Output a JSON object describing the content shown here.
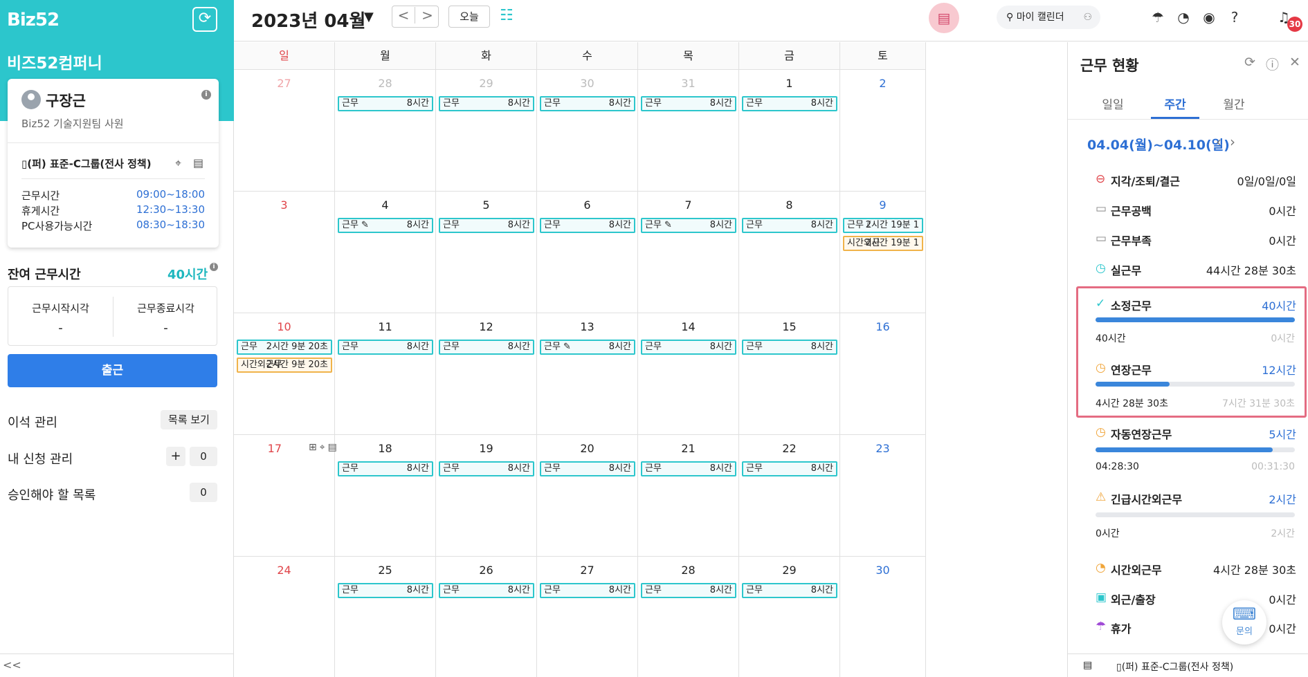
{
  "app": {
    "logo": "Biz52",
    "company": "비즈52컴퍼니"
  },
  "user": {
    "name": "구장근",
    "dept": "Biz52 기술지원팀 사원",
    "policy": "(퍼) 표준-C그룹(전사 정책)",
    "times": [
      {
        "label": "근무시간",
        "value": "09:00~18:00"
      },
      {
        "label": "휴게시간",
        "value": "12:30~13:30"
      },
      {
        "label": "PC사용가능시간",
        "value": "08:30~18:30"
      }
    ]
  },
  "remaining": {
    "label": "잔여 근무시간",
    "value": "40시간"
  },
  "clock": {
    "start_label": "근무시작시각",
    "start_value": "-",
    "end_label": "근무종료시각",
    "end_value": "-"
  },
  "checkin_label": "출근",
  "side": {
    "away": "이석 관리",
    "list_view": "목록 보기",
    "my_requests": "내 신청 관리",
    "my_requests_plus": "+",
    "my_requests_count": "0",
    "approve": "승인해야 할 목록",
    "approve_count": "0",
    "collapse": "<<"
  },
  "header": {
    "month": "2023년 04월",
    "caret": "▼",
    "prev": "<",
    "next": ">",
    "today": "오늘",
    "my_calendar": "마이 캘린더",
    "notif_count": "30"
  },
  "weekdays": [
    "일",
    "월",
    "화",
    "수",
    "목",
    "금",
    "토"
  ],
  "calendar": {
    "weeks": [
      {
        "days": [
          "27",
          "28",
          "29",
          "30",
          "31",
          "1",
          "2"
        ],
        "other": [
          true,
          true,
          true,
          true,
          true,
          false,
          false
        ]
      },
      {
        "days": [
          "3",
          "4",
          "5",
          "6",
          "7",
          "8",
          "9"
        ],
        "other": [
          false,
          false,
          false,
          false,
          false,
          false,
          false
        ]
      },
      {
        "days": [
          "10",
          "11",
          "12",
          "13",
          "14",
          "15",
          "16"
        ],
        "other": [
          false,
          false,
          false,
          false,
          false,
          false,
          false
        ]
      },
      {
        "days": [
          "17",
          "18",
          "19",
          "20",
          "21",
          "22",
          "23"
        ],
        "other": [
          false,
          false,
          false,
          false,
          false,
          false,
          false
        ]
      },
      {
        "days": [
          "24",
          "25",
          "26",
          "27",
          "28",
          "29",
          "30"
        ],
        "other": [
          false,
          false,
          false,
          false,
          false,
          false,
          false
        ]
      }
    ],
    "work_label": "근무",
    "hours_label": "8시간",
    "sat9_work": "2시간 19분 1",
    "sat9_ot_label": "시간외근",
    "sat9_ot": "2시간 19분 1",
    "sun10_work": "2시간 9분 20초",
    "sun10_ot_label": "시간외근무",
    "sun10_ot": "2시간 9분 20초"
  },
  "panel": {
    "title": "근무 현황",
    "tabs": [
      "일일",
      "주간",
      "월간"
    ],
    "active_tab": 1,
    "range": "04.04(월)~04.10(일)",
    "stats": [
      {
        "label": "지각/조퇴/결근",
        "value": "0일/0일/0일",
        "icon": "minus-circle-icon"
      },
      {
        "label": "근무공백",
        "value": "0시간",
        "icon": "monitor-icon"
      },
      {
        "label": "근무부족",
        "value": "0시간",
        "icon": "monitor-alert-icon"
      },
      {
        "label": "실근무",
        "value": "44시간 28분 30초",
        "icon": "alarm-icon"
      }
    ],
    "regular": {
      "label": "소정근무",
      "value": "40시간",
      "progress": 1.0,
      "left": "40시간",
      "right": "0시간"
    },
    "overtime": {
      "label": "연장근무",
      "value": "12시간",
      "progress": 0.37,
      "left": "4시간 28분 30초",
      "right": "7시간 31분 30초"
    },
    "auto_ot": {
      "label": "자동연장근무",
      "value": "5시간",
      "progress": 0.89,
      "left": "04:28:30",
      "right": "00:31:30"
    },
    "urgent": {
      "label": "긴급시간외근무",
      "value": "2시간",
      "progress": 0.0,
      "left": "0시간",
      "right": "2시간"
    },
    "extra": [
      {
        "label": "시간외근무",
        "value": "4시간 28분 30초"
      },
      {
        "label": "외근/출장",
        "value": "0시간"
      },
      {
        "label": "휴가",
        "value": "0시간"
      }
    ],
    "footer_policy": "(퍼) 표준-C그룹(전사 정책)",
    "chat": "문의"
  }
}
